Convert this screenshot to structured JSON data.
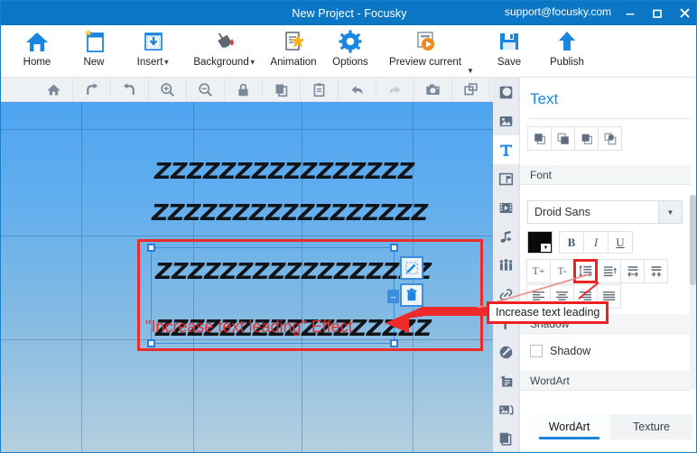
{
  "window": {
    "title": "New Project - Focusky",
    "support_email": "support@focusky.com",
    "minimize_label": "Minimize",
    "maximize_label": "Maximize",
    "close_label": "Close"
  },
  "ribbon": {
    "items": [
      {
        "label": "Home",
        "icon": "home-icon",
        "dropdown": false
      },
      {
        "label": "New",
        "icon": "new-document-icon",
        "dropdown": false
      },
      {
        "label": "Insert",
        "icon": "insert-icon",
        "dropdown": true
      },
      {
        "label": "Background",
        "icon": "paint-bucket-icon",
        "dropdown": true
      },
      {
        "label": "Animation",
        "icon": "animation-icon",
        "dropdown": false
      },
      {
        "label": "Options",
        "icon": "gear-icon",
        "dropdown": false
      },
      {
        "label": "Preview current",
        "icon": "preview-play-icon",
        "dropdown": true
      },
      {
        "label": "Save",
        "icon": "save-icon",
        "dropdown": false
      },
      {
        "label": "Publish",
        "icon": "publish-upload-icon",
        "dropdown": false
      }
    ]
  },
  "canvas_toolbar": {
    "buttons": [
      {
        "name": "home-icon",
        "title": "Home",
        "disabled": false
      },
      {
        "name": "redo-arrow-icon",
        "title": "Rotate right",
        "disabled": false
      },
      {
        "name": "undo-arrow-icon",
        "title": "Rotate left",
        "disabled": false
      },
      {
        "name": "zoom-in-icon",
        "title": "Zoom in",
        "disabled": false
      },
      {
        "name": "zoom-out-icon",
        "title": "Zoom out",
        "disabled": false
      },
      {
        "name": "lock-icon",
        "title": "Lock",
        "disabled": false
      },
      {
        "name": "copy-icon",
        "title": "Copy",
        "disabled": false
      },
      {
        "name": "paste-icon",
        "title": "Paste",
        "disabled": false
      },
      {
        "name": "undo-icon",
        "title": "Undo",
        "disabled": false
      },
      {
        "name": "redo-icon",
        "title": "Redo",
        "disabled": true
      },
      {
        "name": "camera-icon",
        "title": "Screenshot",
        "disabled": false
      },
      {
        "name": "duplicate-icon",
        "title": "Duplicate",
        "disabled": false
      }
    ]
  },
  "canvas": {
    "background_top_color": "#4ea4ef",
    "background_bottom_color": "#b5cfdf",
    "text_lines": [
      "ZZZZZZZZZZZZZZZZ",
      "ZZZZZZZZZZZZZZZZZ",
      "ZZZZZZZZZZZZZZZZZ",
      "ZZZZZZZZZZZZZZZZZ"
    ],
    "caption": "\"Increase text leading\" Effect",
    "caption_color": "#ed2b2b",
    "highlight_color": "#ef2a2a",
    "selection_color": "#3d8fdd",
    "edit_button": "edit-pencil-icon",
    "delete_button": "trash-icon",
    "resize_handle": "horizontal-resize-handle"
  },
  "vertical_strip": {
    "items": [
      {
        "name": "sidebar-item-shape",
        "icon": "shape-icon",
        "active": false
      },
      {
        "name": "sidebar-item-image",
        "icon": "image-icon",
        "active": false
      },
      {
        "name": "sidebar-item-text",
        "icon": "text-T-icon",
        "active": true
      },
      {
        "name": "sidebar-item-flag",
        "icon": "flag-board-icon",
        "active": false
      },
      {
        "name": "sidebar-item-video",
        "icon": "video-film-icon",
        "active": false
      },
      {
        "name": "sidebar-item-music",
        "icon": "music-note-icon",
        "active": false
      },
      {
        "name": "sidebar-item-characters",
        "icon": "people-group-icon",
        "active": false
      },
      {
        "name": "sidebar-item-link",
        "icon": "link-chain-icon",
        "active": false
      },
      {
        "name": "sidebar-item-paint",
        "icon": "paint-roller-icon",
        "active": false
      },
      {
        "name": "sidebar-item-brush",
        "icon": "brush-disc-icon",
        "active": false
      },
      {
        "name": "sidebar-item-notes",
        "icon": "notes-icon",
        "active": false
      },
      {
        "name": "sidebar-item-gallery",
        "icon": "gallery-icon",
        "active": false
      },
      {
        "name": "sidebar-item-layers",
        "icon": "layers-icon",
        "active": false
      }
    ]
  },
  "panel": {
    "title": "Text",
    "arrange_buttons": [
      {
        "name": "bring-to-front-button",
        "icon": "bring-to-front-icon"
      },
      {
        "name": "send-to-back-button",
        "icon": "send-to-back-icon"
      },
      {
        "name": "bring-forward-button",
        "icon": "bring-forward-icon"
      },
      {
        "name": "send-backward-button",
        "icon": "send-backward-icon"
      }
    ],
    "font_section": {
      "header": "Font",
      "family": "Droid Sans",
      "dropdown_icon": "chevron-down-icon",
      "color": "#0a0a0a",
      "color_picker_icon": "color-swatch-dropdown-icon",
      "style_buttons": [
        {
          "name": "bold-button",
          "label": "B"
        },
        {
          "name": "italic-button",
          "label": "I"
        },
        {
          "name": "underline-button",
          "label": "U"
        }
      ],
      "format_buttons": [
        {
          "name": "increase-font-size-button",
          "label": "T+",
          "selected": false
        },
        {
          "name": "decrease-font-size-button",
          "label": "T-",
          "selected": false
        },
        {
          "name": "increase-text-leading-button",
          "icon": "increase-leading-icon",
          "selected": true
        },
        {
          "name": "decrease-text-leading-button",
          "icon": "decrease-leading-icon",
          "selected": false
        },
        {
          "name": "increase-letter-spacing-button",
          "icon": "increase-spacing-icon",
          "selected": false
        },
        {
          "name": "decrease-letter-spacing-button",
          "icon": "decrease-spacing-icon",
          "selected": false
        }
      ],
      "align_buttons": [
        {
          "name": "align-left-button",
          "icon": "align-left-icon"
        },
        {
          "name": "align-center-button",
          "icon": "align-center-icon"
        },
        {
          "name": "align-right-button",
          "icon": "align-right-icon"
        },
        {
          "name": "align-justify-button",
          "icon": "align-justify-icon"
        }
      ]
    },
    "shadow_section": {
      "header": "Shadow",
      "checkbox_label": "Shadow",
      "checked": false
    },
    "wordart_section": {
      "header": "WordArt",
      "tabs": [
        {
          "label": "WordArt",
          "active": true
        },
        {
          "label": "Texture",
          "active": false
        }
      ]
    }
  },
  "tooltip": {
    "text": "Increase text leading",
    "border_color": "#ee2222"
  }
}
